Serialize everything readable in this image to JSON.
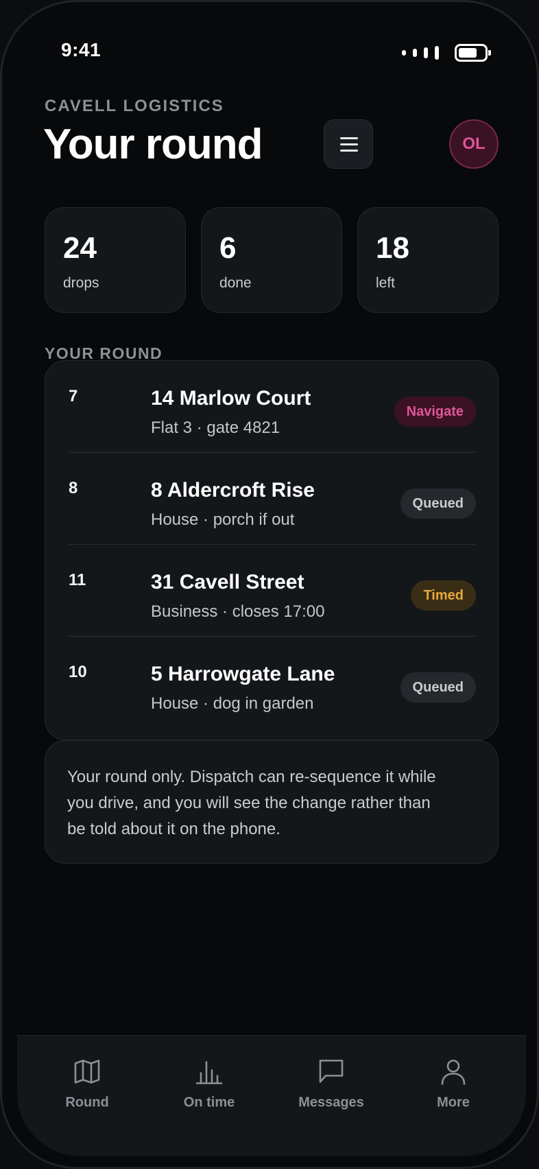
{
  "status_bar": {
    "time": "9:41"
  },
  "header": {
    "company": "CAVELL LOGISTICS",
    "title": "Your round",
    "avatar_initials": "OL"
  },
  "stats": [
    {
      "value": "24",
      "label": "drops"
    },
    {
      "value": "6",
      "label": "done"
    },
    {
      "value": "18",
      "label": "left"
    }
  ],
  "round": {
    "section_label": "YOUR ROUND",
    "stops": [
      {
        "seq": "7",
        "address": "14 Marlow Court",
        "detail": "Flat 3 · gate 4821",
        "status": "Navigate"
      },
      {
        "seq": "8",
        "address": "8 Aldercroft Rise",
        "detail": "House · porch if out",
        "status": "Queued"
      },
      {
        "seq": "11",
        "address": "31 Cavell Street",
        "detail": "Business · closes 17:00",
        "status": "Timed"
      },
      {
        "seq": "10",
        "address": "5 Harrowgate Lane",
        "detail": "House · dog in garden",
        "status": "Queued"
      }
    ]
  },
  "note": {
    "text": "Your round only. Dispatch can re-sequence it while you drive, and you will see the change rather than be told about it on the phone."
  },
  "tabbar": {
    "items": [
      {
        "label": "Round",
        "icon": "map-icon"
      },
      {
        "label": "On time",
        "icon": "bar-chart-icon"
      },
      {
        "label": "Messages",
        "icon": "message-icon"
      },
      {
        "label": "More",
        "icon": "user-icon"
      }
    ]
  },
  "colors": {
    "accent": "#e0559a",
    "timed": "#e6a93a",
    "background": "#08090b",
    "card": "#14171a"
  }
}
